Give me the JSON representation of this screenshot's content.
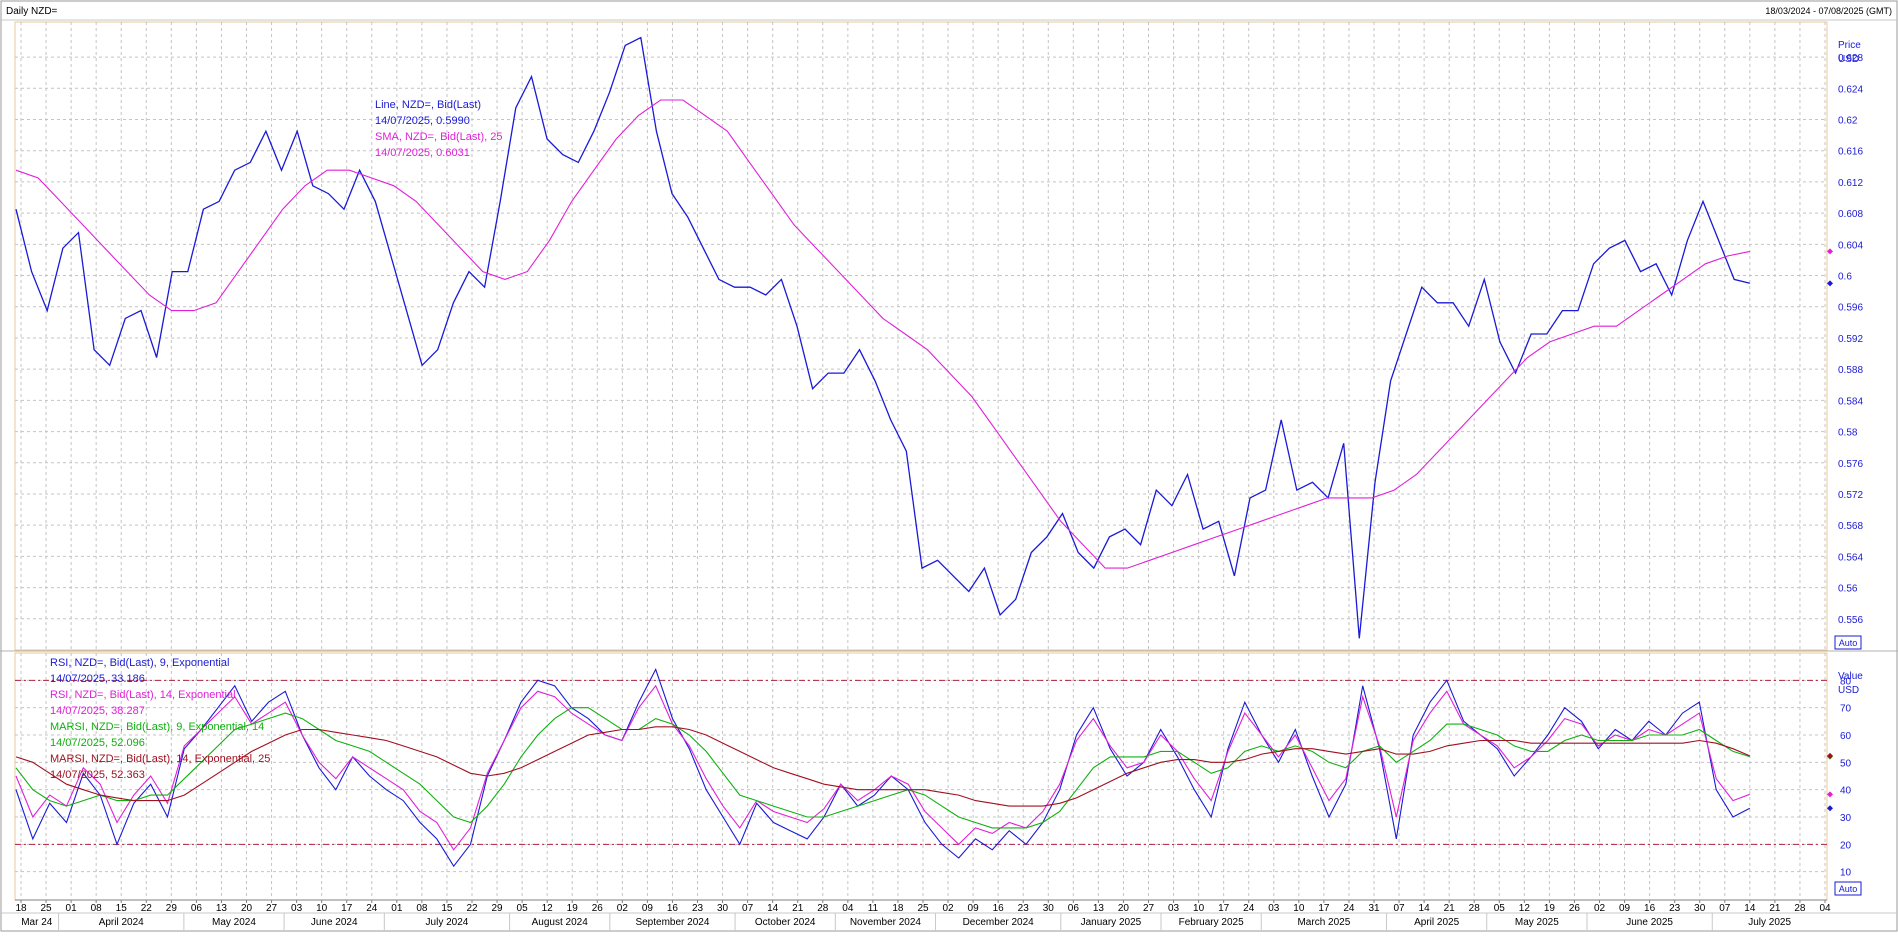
{
  "header": {
    "title": "Daily NZD=",
    "range": "18/03/2024 - 07/08/2025 (GMT)"
  },
  "price_panel": {
    "axis_title": "Price",
    "axis_unit": "USD",
    "auto_label": "Auto",
    "legend": [
      {
        "text": "Line, NZD=, Bid(Last)",
        "color": "#1a1ad6"
      },
      {
        "text": "14/07/2025, 0.5990",
        "color": "#1a1ad6"
      },
      {
        "text": "SMA, NZD=, Bid(Last),  25",
        "color": "#e020d8"
      },
      {
        "text": "14/07/2025, 0.6031",
        "color": "#e020d8"
      }
    ]
  },
  "rsi_panel": {
    "axis_title": "Value",
    "axis_unit": "USD",
    "auto_label": "Auto",
    "legend": [
      {
        "text": "RSI, NZD=, Bid(Last),  9, Exponential",
        "color": "#1a1ad6"
      },
      {
        "text": "14/07/2025, 33.186",
        "color": "#1a1ad6"
      },
      {
        "text": "RSI, NZD=, Bid(Last),  14, Exponential",
        "color": "#e020d8"
      },
      {
        "text": "14/07/2025, 38.287",
        "color": "#e020d8"
      },
      {
        "text": "MARSI, NZD=, Bid(Last),  9, Exponential, 14",
        "color": "#10b010"
      },
      {
        "text": "14/07/2025, 52.096",
        "color": "#10b010"
      },
      {
        "text": "MARSI, NZD=, Bid(Last),  14, Exponential, 25",
        "color": "#a01020"
      },
      {
        "text": "14/07/2025, 52.363",
        "color": "#a01020"
      }
    ]
  },
  "chart_data": [
    {
      "type": "line",
      "title": "Daily NZD=",
      "ylabel": "Price USD",
      "ylim": [
        0.552,
        0.6325
      ],
      "yticks": [
        0.556,
        0.56,
        0.564,
        0.568,
        0.572,
        0.576,
        0.58,
        0.584,
        0.588,
        0.592,
        0.596,
        0.6,
        0.604,
        0.608,
        0.612,
        0.616,
        0.62,
        0.624,
        0.628
      ],
      "grid": true,
      "series": [
        {
          "name": "Line, NZD=, Bid(Last)",
          "color": "#1a1ad6",
          "values": [
            0.6085,
            0.6005,
            0.5955,
            0.6035,
            0.6055,
            0.5905,
            0.5885,
            0.5945,
            0.5955,
            0.5895,
            0.6005,
            0.6005,
            0.6085,
            0.6095,
            0.6135,
            0.6145,
            0.6185,
            0.6135,
            0.6185,
            0.6115,
            0.6105,
            0.6085,
            0.6135,
            0.6095,
            0.6025,
            0.5955,
            0.5885,
            0.5905,
            0.5965,
            0.6005,
            0.5985,
            0.6095,
            0.6215,
            0.6255,
            0.6175,
            0.6155,
            0.6145,
            0.6185,
            0.6235,
            0.6295,
            0.6305,
            0.6185,
            0.6105,
            0.6075,
            0.6035,
            0.5995,
            0.5985,
            0.5985,
            0.5975,
            0.5995,
            0.5935,
            0.5855,
            0.5875,
            0.5875,
            0.5905,
            0.5865,
            0.5815,
            0.5775,
            0.5625,
            0.5635,
            0.5615,
            0.5595,
            0.5625,
            0.5565,
            0.5585,
            0.5645,
            0.5665,
            0.5695,
            0.5645,
            0.5625,
            0.5665,
            0.5675,
            0.5655,
            0.5725,
            0.5705,
            0.5745,
            0.5675,
            0.5685,
            0.5615,
            0.5715,
            0.5725,
            0.5815,
            0.5725,
            0.5735,
            0.5715,
            0.5785,
            0.5535,
            0.5735,
            0.5865,
            0.5925,
            0.5985,
            0.5965,
            0.5965,
            0.5935,
            0.5995,
            0.5915,
            0.5875,
            0.5925,
            0.5925,
            0.5955,
            0.5955,
            0.6015,
            0.6035,
            0.6045,
            0.6005,
            0.6015,
            0.5975,
            0.6045,
            0.6095,
            0.6045,
            0.5995,
            0.599
          ]
        },
        {
          "name": "SMA, NZD=, Bid(Last),  25",
          "color": "#e020d8",
          "values": [
            0.6135,
            0.6125,
            0.6095,
            0.6065,
            0.6035,
            0.6005,
            0.5975,
            0.5955,
            0.5955,
            0.5965,
            0.6005,
            0.6045,
            0.6085,
            0.6115,
            0.6135,
            0.6135,
            0.6125,
            0.6115,
            0.6095,
            0.6065,
            0.6035,
            0.6005,
            0.5995,
            0.6005,
            0.6045,
            0.6095,
            0.6135,
            0.6175,
            0.6205,
            0.6225,
            0.6225,
            0.6205,
            0.6185,
            0.6145,
            0.6105,
            0.6065,
            0.6035,
            0.6005,
            0.5975,
            0.5945,
            0.5925,
            0.5905,
            0.5875,
            0.5845,
            0.5805,
            0.5765,
            0.5725,
            0.5685,
            0.5655,
            0.5625,
            0.5625,
            0.5635,
            0.5645,
            0.5655,
            0.5665,
            0.5675,
            0.5685,
            0.5695,
            0.5705,
            0.5715,
            0.5715,
            0.5715,
            0.5725,
            0.5745,
            0.5775,
            0.5805,
            0.5835,
            0.5865,
            0.5895,
            0.5915,
            0.5925,
            0.5935,
            0.5935,
            0.5955,
            0.5975,
            0.5995,
            0.6015,
            0.6025,
            0.6031
          ]
        }
      ]
    },
    {
      "type": "line",
      "title": "RSI",
      "ylabel": "Value USD",
      "ylim": [
        0,
        90
      ],
      "yticks": [
        10,
        20,
        30,
        40,
        50,
        60,
        70,
        80
      ],
      "reference_lines": [
        20,
        80
      ],
      "grid": true,
      "series": [
        {
          "name": "RSI, NZD=, Bid(Last),  9, Exponential",
          "color": "#1a1ad6",
          "values": [
            40,
            22,
            35,
            28,
            46,
            38,
            20,
            35,
            42,
            30,
            55,
            62,
            70,
            78,
            65,
            72,
            76,
            60,
            48,
            40,
            52,
            45,
            40,
            36,
            28,
            22,
            12,
            20,
            45,
            58,
            72,
            80,
            78,
            70,
            66,
            60,
            58,
            72,
            84,
            66,
            55,
            40,
            30,
            20,
            35,
            28,
            25,
            22,
            30,
            42,
            34,
            38,
            45,
            40,
            28,
            20,
            15,
            22,
            18,
            25,
            20,
            28,
            40,
            60,
            70,
            55,
            45,
            50,
            62,
            52,
            40,
            30,
            55,
            72,
            60,
            50,
            62,
            45,
            30,
            42,
            78,
            55,
            22,
            60,
            72,
            80,
            65,
            60,
            55,
            45,
            52,
            60,
            70,
            65,
            55,
            62,
            58,
            65,
            60,
            68,
            72,
            40,
            30,
            33.186
          ]
        },
        {
          "name": "RSI, NZD=, Bid(Last),  14, Exponential",
          "color": "#e020d8",
          "values": [
            45,
            30,
            38,
            34,
            48,
            42,
            28,
            38,
            45,
            35,
            56,
            62,
            68,
            74,
            64,
            68,
            72,
            60,
            50,
            44,
            52,
            48,
            44,
            40,
            32,
            28,
            18,
            26,
            46,
            58,
            70,
            76,
            74,
            68,
            64,
            60,
            58,
            70,
            78,
            64,
            56,
            44,
            34,
            26,
            36,
            32,
            30,
            28,
            33,
            42,
            36,
            40,
            45,
            42,
            32,
            26,
            20,
            26,
            24,
            28,
            26,
            32,
            42,
            58,
            66,
            56,
            48,
            50,
            60,
            54,
            44,
            36,
            54,
            68,
            60,
            52,
            60,
            48,
            36,
            44,
            74,
            56,
            30,
            58,
            68,
            76,
            64,
            60,
            56,
            48,
            52,
            58,
            66,
            64,
            56,
            60,
            58,
            62,
            60,
            64,
            68,
            44,
            36,
            38.287
          ]
        },
        {
          "name": "MARSI, NZD=, Bid(Last),  9, Exponential, 14",
          "color": "#10b010",
          "values": [
            48,
            40,
            36,
            34,
            36,
            38,
            36,
            36,
            38,
            38,
            44,
            50,
            56,
            62,
            64,
            66,
            68,
            66,
            62,
            58,
            56,
            54,
            50,
            46,
            42,
            36,
            30,
            28,
            34,
            42,
            52,
            60,
            66,
            70,
            70,
            66,
            62,
            62,
            66,
            64,
            60,
            54,
            46,
            38,
            36,
            34,
            32,
            30,
            30,
            32,
            34,
            36,
            38,
            40,
            38,
            34,
            30,
            28,
            26,
            26,
            26,
            28,
            32,
            40,
            48,
            52,
            52,
            52,
            54,
            54,
            50,
            46,
            48,
            54,
            56,
            54,
            56,
            54,
            50,
            48,
            54,
            56,
            50,
            54,
            58,
            64,
            64,
            62,
            60,
            56,
            54,
            54,
            58,
            60,
            58,
            58,
            58,
            60,
            60,
            60,
            62,
            58,
            54,
            52.096
          ]
        },
        {
          "name": "MARSI, NZD=, Bid(Last),  14, Exponential, 25",
          "color": "#a01020",
          "values": [
            52,
            50,
            46,
            42,
            40,
            38,
            37,
            36,
            36,
            36,
            38,
            42,
            46,
            50,
            54,
            57,
            60,
            62,
            62,
            61,
            60,
            59,
            58,
            56,
            54,
            52,
            49,
            46,
            45,
            46,
            48,
            51,
            54,
            57,
            60,
            61,
            62,
            62,
            63,
            63,
            62,
            60,
            57,
            54,
            51,
            48,
            46,
            44,
            42,
            41,
            40,
            40,
            40,
            40,
            40,
            39,
            38,
            36,
            35,
            34,
            34,
            34,
            35,
            37,
            40,
            43,
            46,
            48,
            50,
            51,
            51,
            50,
            50,
            51,
            53,
            54,
            55,
            55,
            54,
            53,
            54,
            55,
            53,
            53,
            54,
            56,
            57,
            58,
            58,
            58,
            57,
            57,
            57,
            57,
            57,
            57,
            57,
            57,
            57,
            57,
            58,
            57,
            55,
            52.363
          ]
        }
      ]
    }
  ],
  "x_axis": {
    "days": [
      "18",
      "25",
      "01",
      "08",
      "15",
      "22",
      "29",
      "06",
      "13",
      "20",
      "27",
      "03",
      "10",
      "17",
      "24",
      "01",
      "08",
      "15",
      "22",
      "29",
      "05",
      "12",
      "19",
      "26",
      "02",
      "09",
      "16",
      "23",
      "30",
      "07",
      "14",
      "21",
      "28",
      "04",
      "11",
      "18",
      "25",
      "02",
      "09",
      "16",
      "23",
      "30",
      "06",
      "13",
      "20",
      "27",
      "03",
      "10",
      "17",
      "24",
      "03",
      "10",
      "17",
      "24",
      "31",
      "07",
      "14",
      "21",
      "28",
      "05",
      "12",
      "19",
      "26",
      "02",
      "09",
      "16",
      "23",
      "30",
      "07",
      "14",
      "21",
      "28",
      "04"
    ],
    "months": [
      "Mar 24",
      "April 2024",
      "May 2024",
      "June 2024",
      "July 2024",
      "August 2024",
      "September 2024",
      "October 2024",
      "November 2024",
      "December 2024",
      "January 2025",
      "February 2025",
      "March 2025",
      "April 2025",
      "May 2025",
      "June 2025",
      "July 2025"
    ]
  }
}
